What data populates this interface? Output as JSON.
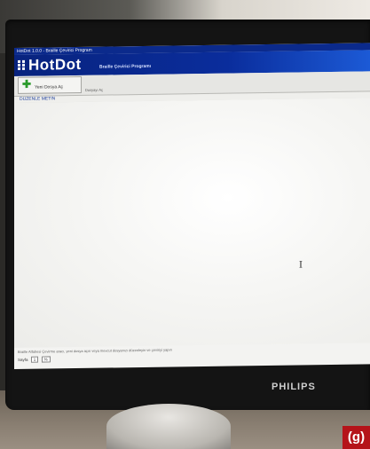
{
  "window": {
    "title": "HotDot 1.0.0 - Braille Çevirici Program"
  },
  "banner": {
    "brand": "HotDot",
    "subtitle": "Braille Çevirici Programı"
  },
  "toolbar": {
    "new_button_label": "Yeni Dosya Aç",
    "hint_text": "Dosyayı Aç"
  },
  "section": {
    "title": "DÜZENLE METİN"
  },
  "editor": {
    "cursor_glyph": "I"
  },
  "status": {
    "message": "Braille Alfabesi Çevirme aracı, yeni dosya açın veya mevcut dosyanızı düzenleyin ve çeviriyi yapın",
    "page_label": "Sayfa",
    "page_value": "1",
    "zoom_value": "%"
  },
  "monitor": {
    "brand": "PHILIPS"
  },
  "figure_tag": "(g)",
  "colors": {
    "title_blue": "#0b2a8c",
    "banner_blue": "#0a2d9c",
    "tag_red": "#b5141a"
  }
}
